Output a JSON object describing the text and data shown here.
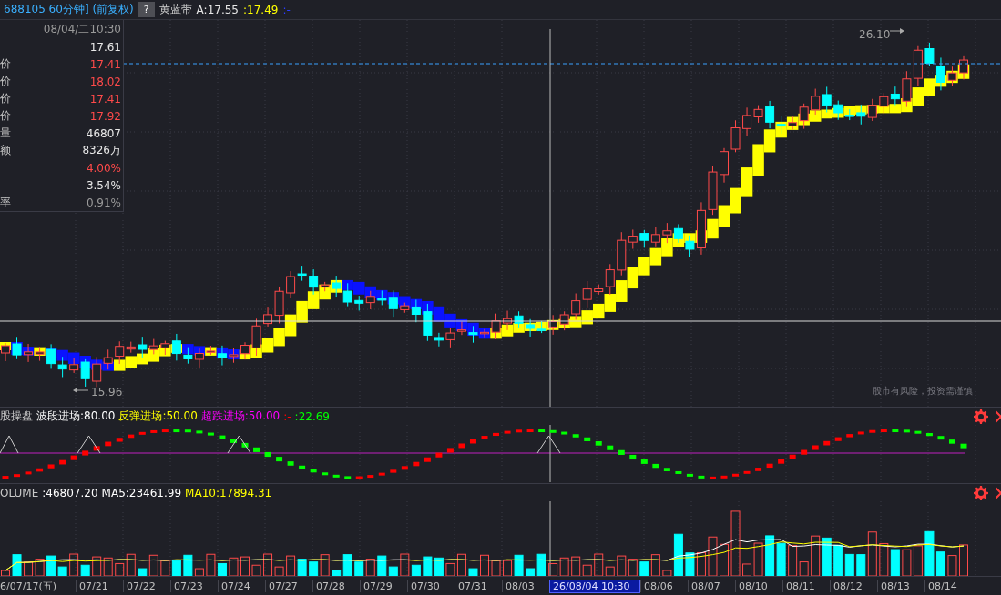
{
  "header": {
    "title": "688105 60分钟] (前复权)",
    "help_button": "?",
    "indicator": "黄蓝带",
    "values": [
      {
        "text": "A:17.55",
        "color": "#e6e6e6"
      },
      {
        "text": ":17.49",
        "color": "#ffff00"
      },
      {
        "text": ":-",
        "color": "#2a3cff"
      }
    ]
  },
  "info_panel": {
    "rows": [
      {
        "value": "08/04/二10:30",
        "kind": "muted"
      },
      {
        "value": "17.61",
        "kind": "plain"
      },
      {
        "label": "价",
        "value": "17.41",
        "kind": "up"
      },
      {
        "label": "价",
        "value": "18.02",
        "kind": "up"
      },
      {
        "label": "价",
        "value": "17.41",
        "kind": "up"
      },
      {
        "label": "价",
        "value": "17.92",
        "kind": "up"
      },
      {
        "label": "量",
        "value": "46807",
        "kind": "plain"
      },
      {
        "label": "额",
        "value": "8326万",
        "kind": "plain"
      },
      {
        "value": "4.00%",
        "kind": "up"
      },
      {
        "value": "3.54%",
        "kind": "plain"
      },
      {
        "label": "率",
        "value": "0.91%",
        "kind": "muted"
      }
    ]
  },
  "main_chart": {
    "high_label": "26.10",
    "low_label": "15.96",
    "disclaimer": "股市有风险，投资需谨慎"
  },
  "indicator_panel": {
    "name": "股操盘",
    "values": [
      {
        "text": "波段进场:80.00",
        "color": "#ffffff"
      },
      {
        "text": "反弹进场:50.00",
        "color": "#ffff00"
      },
      {
        "text": "超跌进场:50.00",
        "color": "#ff00ff"
      },
      {
        "text": ":-",
        "color": "#ff0000"
      },
      {
        "text": ":22.69",
        "color": "#00ff00"
      }
    ]
  },
  "volume_panel": {
    "name": "OLUME",
    "values": [
      {
        "text": ":46807.20",
        "color": "#ffffff"
      },
      {
        "text": "MA5:23461.99",
        "color": "#ffffff"
      },
      {
        "text": "MA10:17894.31",
        "color": "#ffff00"
      }
    ]
  },
  "x_axis": [
    {
      "label": "6/07/17(五)",
      "selected": false
    },
    {
      "label": "07/21",
      "selected": false
    },
    {
      "label": "07/22",
      "selected": false
    },
    {
      "label": "07/23",
      "selected": false
    },
    {
      "label": "07/24",
      "selected": false
    },
    {
      "label": "07/27",
      "selected": false
    },
    {
      "label": "07/28",
      "selected": false
    },
    {
      "label": "07/29",
      "selected": false
    },
    {
      "label": "07/30",
      "selected": false
    },
    {
      "label": "07/31",
      "selected": false
    },
    {
      "label": "08/03",
      "selected": false
    },
    {
      "label": "26/08/04 10:30",
      "selected": true
    },
    {
      "label": "08/06",
      "selected": false
    },
    {
      "label": "08/07",
      "selected": false
    },
    {
      "label": "08/10",
      "selected": false
    },
    {
      "label": "08/11",
      "selected": false
    },
    {
      "label": "08/12",
      "selected": false
    },
    {
      "label": "08/13",
      "selected": false
    },
    {
      "label": "08/14",
      "selected": false
    }
  ]
}
